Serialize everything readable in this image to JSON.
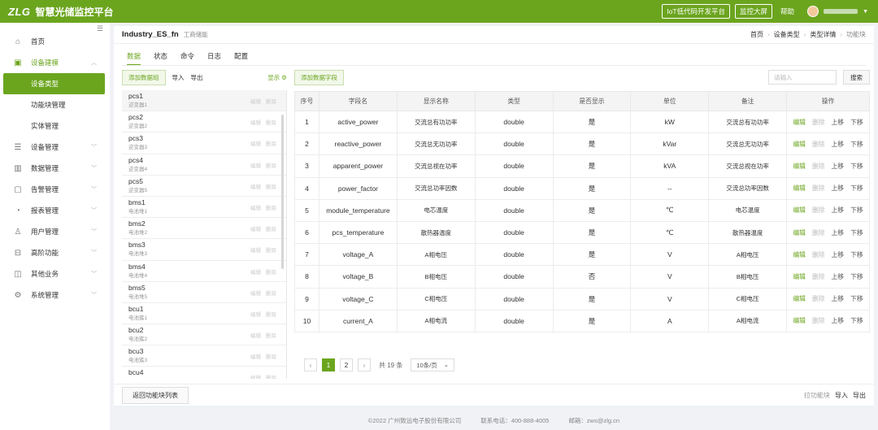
{
  "brand": {
    "logo": "ZLG",
    "app_name": "智慧光储监控平台"
  },
  "topbar": {
    "iot_btn": "IoT低代码开发平台",
    "screen_btn": "监控大屏",
    "help": "帮助"
  },
  "sidebar": {
    "items": [
      {
        "label": "首页",
        "icon": "home-icon",
        "glyph": "⌂"
      },
      {
        "label": "设备建模",
        "icon": "model-icon",
        "glyph": "▣",
        "open": true,
        "children": [
          {
            "label": "设备类型",
            "active": true
          },
          {
            "label": "功能块管理"
          },
          {
            "label": "实体管理"
          }
        ]
      },
      {
        "label": "设备管理",
        "icon": "device-icon",
        "glyph": "☰"
      },
      {
        "label": "数据管理",
        "icon": "chart-icon",
        "glyph": "▥"
      },
      {
        "label": "告警管理",
        "icon": "alarm-icon",
        "glyph": "▢"
      },
      {
        "label": "报表管理",
        "icon": "report-icon",
        "glyph": "◔"
      },
      {
        "label": "用户管理",
        "icon": "user-icon",
        "glyph": "♙"
      },
      {
        "label": "高阶功能",
        "icon": "toolbox-icon",
        "glyph": "⊟"
      },
      {
        "label": "其他业务",
        "icon": "misc-icon",
        "glyph": "◫"
      },
      {
        "label": "系统管理",
        "icon": "settings-icon",
        "glyph": "⚙"
      }
    ]
  },
  "header": {
    "title": "Industry_ES_fn",
    "subtitle": "工商储能",
    "breadcrumb": [
      "首页",
      "设备类型",
      "类型详情",
      "功能块"
    ]
  },
  "tabs": [
    "数据",
    "状态",
    "命令",
    "日志",
    "配置"
  ],
  "left": {
    "add_group": "添加数据组",
    "import": "导入",
    "export": "导出",
    "show": "显示 ⚙",
    "edit": "编辑",
    "delete": "删除",
    "groups": [
      {
        "name": "pcs1",
        "sub": "逆变器1"
      },
      {
        "name": "pcs2",
        "sub": "逆变器2"
      },
      {
        "name": "pcs3",
        "sub": "逆变器3"
      },
      {
        "name": "pcs4",
        "sub": "逆变器4"
      },
      {
        "name": "pcs5",
        "sub": "逆变器5"
      },
      {
        "name": "bms1",
        "sub": "电池堆1"
      },
      {
        "name": "bms2",
        "sub": "电池堆2"
      },
      {
        "name": "bms3",
        "sub": "电池堆3"
      },
      {
        "name": "bms4",
        "sub": "电池堆4"
      },
      {
        "name": "bms5",
        "sub": "电池堆5"
      },
      {
        "name": "bcu1",
        "sub": "电池簇1"
      },
      {
        "name": "bcu2",
        "sub": "电池簇2"
      },
      {
        "name": "bcu3",
        "sub": "电池簇3"
      },
      {
        "name": "bcu4",
        "sub": ""
      }
    ]
  },
  "right": {
    "add_field": "添加数据字段",
    "search_placeholder": "请输入",
    "search_btn": "搜索",
    "columns": [
      "序号",
      "字段名",
      "显示名称",
      "类型",
      "是否显示",
      "单位",
      "备注",
      "操作"
    ],
    "ops": {
      "edit": "编辑",
      "delete": "删除",
      "up": "上移",
      "down": "下移"
    },
    "rows": [
      [
        "1",
        "active_power",
        "交流总有功功率",
        "double",
        "是",
        "kW",
        "交流总有功功率"
      ],
      [
        "2",
        "reactive_power",
        "交流总无功功率",
        "double",
        "是",
        "kVar",
        "交流总无功功率"
      ],
      [
        "3",
        "apparent_power",
        "交流总视在功率",
        "double",
        "是",
        "kVA",
        "交流总视在功率"
      ],
      [
        "4",
        "power_factor",
        "交流总功率因数",
        "double",
        "是",
        "--",
        "交流总功率因数"
      ],
      [
        "5",
        "module_temperature",
        "电芯温度",
        "double",
        "是",
        "℃",
        "电芯温度"
      ],
      [
        "6",
        "pcs_temperature",
        "散热器温度",
        "double",
        "是",
        "℃",
        "散热器温度"
      ],
      [
        "7",
        "voltage_A",
        "A相电压",
        "double",
        "是",
        "V",
        "A相电压"
      ],
      [
        "8",
        "voltage_B",
        "B相电压",
        "double",
        "否",
        "V",
        "B相电压"
      ],
      [
        "9",
        "voltage_C",
        "C相电压",
        "double",
        "是",
        "V",
        "C相电压"
      ],
      [
        "10",
        "current_A",
        "A相电流",
        "double",
        "是",
        "A",
        "A相电流"
      ]
    ],
    "pager": {
      "prev": "‹",
      "pages": [
        "1",
        "2"
      ],
      "next": "›",
      "total": "共 19 条",
      "per_page": "10条/页",
      "caret": "⌄"
    }
  },
  "footer": {
    "back": "返回功能块列表",
    "pull": "拉功能块",
    "import": "导入",
    "export": "导出"
  },
  "copyright": {
    "company": "©2022 广州致远电子股份有限公司",
    "phone": "联系电话：400-888-4005",
    "email": "邮箱：zws@zlg.cn"
  }
}
